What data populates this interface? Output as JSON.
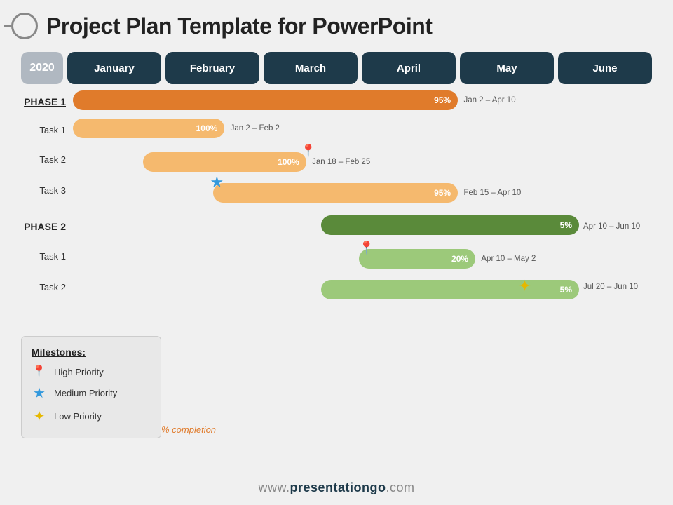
{
  "header": {
    "title": "Project Plan Template for PowerPoint"
  },
  "timeline": {
    "year": "2020",
    "months": [
      "January",
      "February",
      "March",
      "April",
      "May",
      "June"
    ]
  },
  "phases": [
    {
      "id": "phase1",
      "label": "PHASE 1",
      "isPhase": true,
      "barColor": "orange-dark",
      "pct": "95%",
      "dateRange": "Jan 2 – Apr 10",
      "barLeft": "0%",
      "barWidth": "66%"
    },
    {
      "id": "task1-p1",
      "label": "Task 1",
      "isPhase": false,
      "barColor": "orange-light",
      "pct": "100%",
      "dateRange": "Jan 2 – Feb 2",
      "barLeft": "0%",
      "barWidth": "27%"
    },
    {
      "id": "task2-p1",
      "label": "Task 2",
      "isPhase": false,
      "barColor": "orange-light",
      "pct": "100%",
      "dateRange": "Jan 18 – Feb 25",
      "barLeft": "13%",
      "barWidth": "28%",
      "milestone": "high",
      "milestoneOffset": "41%"
    },
    {
      "id": "task3-p1",
      "label": "Task 3",
      "isPhase": false,
      "barColor": "orange-light",
      "pct": "95%",
      "dateRange": "Feb 15 – Apr 10",
      "barLeft": "24%",
      "barWidth": "43%",
      "milestone": "medium",
      "milestoneOffset": "24%"
    }
  ],
  "phase2": {
    "label": "PHASE 2",
    "barColor": "green-dark",
    "pct": "5%",
    "dateRange": "Apr 10 – Jun 10",
    "barLeft": "50%",
    "barWidth": "50%"
  },
  "phase2tasks": [
    {
      "id": "task1-p2",
      "label": "Task 1",
      "barColor": "green-light",
      "pct": "20%",
      "dateRange": "Apr 10 – May 2",
      "barLeft": "50%",
      "barWidth": "18%",
      "milestone": "high",
      "milestoneOffset": "50%"
    },
    {
      "id": "task2-p2",
      "label": "Task 2",
      "barColor": "green-light",
      "pct": "5%",
      "dateRange": "Jul 20 – Jun 10",
      "barLeft": "50%",
      "barWidth": "50%",
      "milestone": "low",
      "milestoneOffset": "88%"
    }
  ],
  "legend": {
    "title": "Milestones:",
    "items": [
      {
        "icon": "📍",
        "label": "High Priority",
        "color": "#c0392b"
      },
      {
        "icon": "⭐",
        "label": "Medium Priority",
        "color": "#3498db"
      },
      {
        "icon": "✦",
        "label": "Low Priority",
        "color": "#e6a817"
      }
    ],
    "pctLabel": "% completion"
  },
  "footer": {
    "text": "www.presentationgo.com"
  }
}
